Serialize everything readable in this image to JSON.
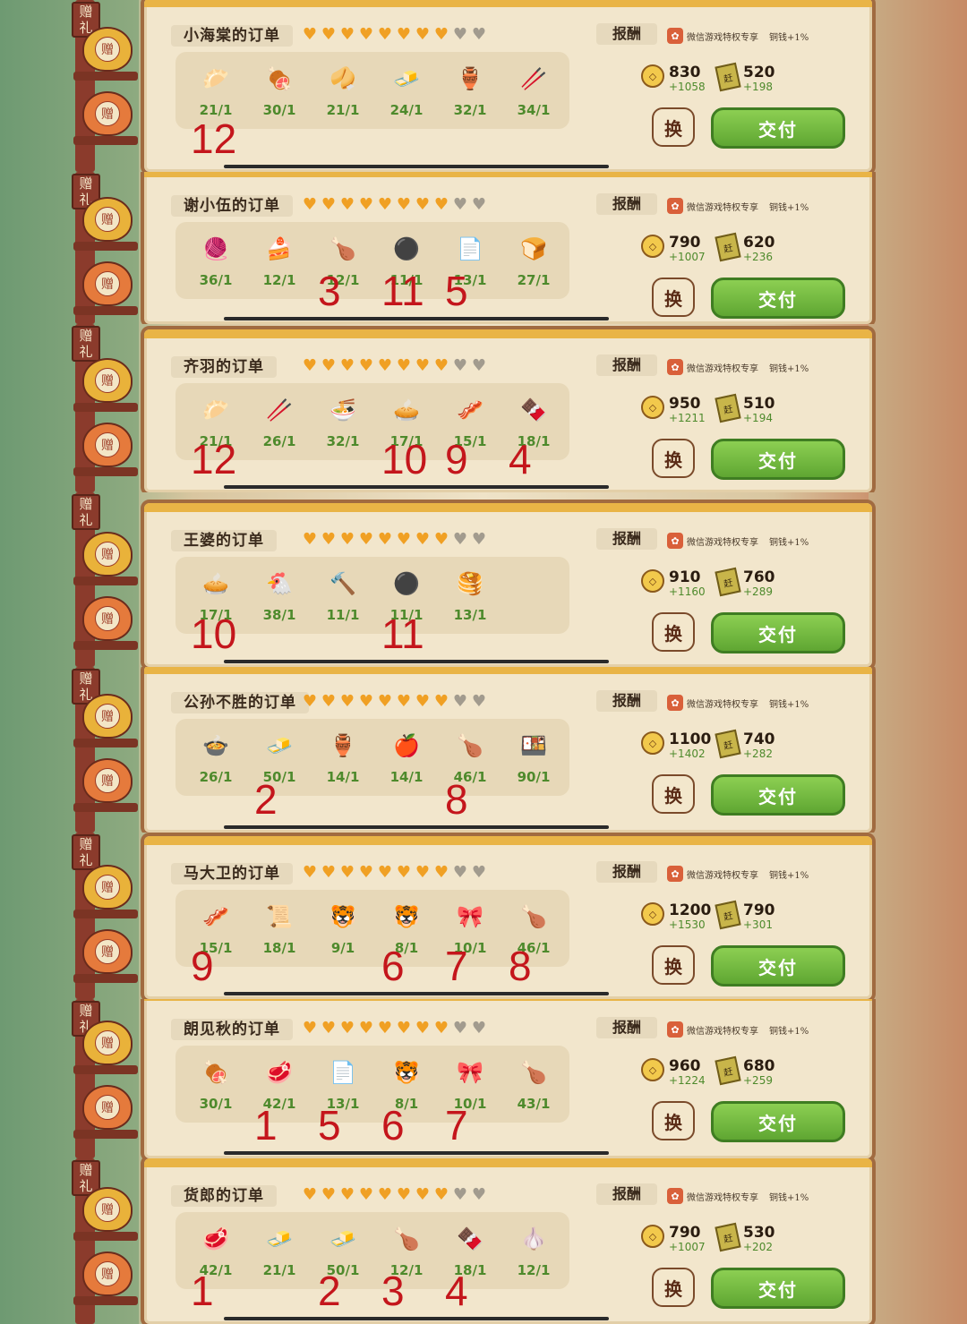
{
  "common": {
    "reward_label": "报酬",
    "vip_text": "微信游戏特权专享",
    "copper_bonus": "铜钱+1%",
    "swap_label": "换",
    "pay_label": "交付",
    "gift_bag_text": "赠",
    "gift_label": "赠礼",
    "coin_symbol": "◇",
    "ticket_symbol": "赶",
    "vip_symbol": "✿"
  },
  "orders": [
    {
      "title": "小海棠的订单",
      "hearts_full": 8,
      "hearts_total": 10,
      "items": [
        {
          "icon": "🥟",
          "count": "21/1"
        },
        {
          "icon": "🍖",
          "count": "30/1"
        },
        {
          "icon": "🥠",
          "count": "21/1"
        },
        {
          "icon": "🧈",
          "count": "24/1"
        },
        {
          "icon": "🏺",
          "count": "32/1"
        },
        {
          "icon": "🥢",
          "count": "34/1"
        }
      ],
      "coins": "830",
      "coins_bonus": "+1058",
      "tickets": "520",
      "tickets_bonus": "+198",
      "marks": [
        {
          "text": "12",
          "pos": 0
        }
      ]
    },
    {
      "title": "谢小伍的订单",
      "hearts_full": 8,
      "hearts_total": 10,
      "items": [
        {
          "icon": "🧶",
          "count": "36/1"
        },
        {
          "icon": "🍰",
          "count": "12/1"
        },
        {
          "icon": "🍗",
          "count": "12/1"
        },
        {
          "icon": "⚫",
          "count": "11/1"
        },
        {
          "icon": "📄",
          "count": "13/1"
        },
        {
          "icon": "🍞",
          "count": "27/1"
        }
      ],
      "coins": "790",
      "coins_bonus": "+1007",
      "tickets": "620",
      "tickets_bonus": "+236",
      "marks": [
        {
          "text": "3",
          "pos": 2
        },
        {
          "text": "11",
          "pos": 3
        },
        {
          "text": "5",
          "pos": 4
        }
      ]
    },
    {
      "title": "齐羽的订单",
      "hearts_full": 8,
      "hearts_total": 10,
      "items": [
        {
          "icon": "🥟",
          "count": "21/1"
        },
        {
          "icon": "🥢",
          "count": "26/1"
        },
        {
          "icon": "🍜",
          "count": "32/1"
        },
        {
          "icon": "🥧",
          "count": "17/1"
        },
        {
          "icon": "🥓",
          "count": "15/1"
        },
        {
          "icon": "🍫",
          "count": "18/1"
        }
      ],
      "coins": "950",
      "coins_bonus": "+1211",
      "tickets": "510",
      "tickets_bonus": "+194",
      "marks": [
        {
          "text": "12",
          "pos": 0
        },
        {
          "text": "10",
          "pos": 3
        },
        {
          "text": "9",
          "pos": 4
        },
        {
          "text": "4",
          "pos": 5
        }
      ]
    },
    {
      "title": "王婆的订单",
      "hearts_full": 8,
      "hearts_total": 10,
      "items": [
        {
          "icon": "🥧",
          "count": "17/1"
        },
        {
          "icon": "🐔",
          "count": "38/1"
        },
        {
          "icon": "🔨",
          "count": "11/1"
        },
        {
          "icon": "⚫",
          "count": "11/1"
        },
        {
          "icon": "🥞",
          "count": "13/1"
        }
      ],
      "coins": "910",
      "coins_bonus": "+1160",
      "tickets": "760",
      "tickets_bonus": "+289",
      "marks": [
        {
          "text": "10",
          "pos": 0
        },
        {
          "text": "11",
          "pos": 3
        }
      ]
    },
    {
      "title": "公孙不胜的订单",
      "hearts_full": 8,
      "hearts_total": 10,
      "items": [
        {
          "icon": "🍲",
          "count": "26/1"
        },
        {
          "icon": "🧈",
          "count": "50/1"
        },
        {
          "icon": "🏺",
          "count": "14/1"
        },
        {
          "icon": "🍎",
          "count": "14/1"
        },
        {
          "icon": "🍗",
          "count": "46/1"
        },
        {
          "icon": "🍱",
          "count": "90/1"
        }
      ],
      "coins": "1100",
      "coins_bonus": "+1402",
      "tickets": "740",
      "tickets_bonus": "+282",
      "marks": [
        {
          "text": "2",
          "pos": 1
        },
        {
          "text": "8",
          "pos": 4
        }
      ]
    },
    {
      "title": "马大卫的订单",
      "hearts_full": 8,
      "hearts_total": 10,
      "items": [
        {
          "icon": "🥓",
          "count": "15/1"
        },
        {
          "icon": "📜",
          "count": "18/1"
        },
        {
          "icon": "🐯",
          "count": "9/1"
        },
        {
          "icon": "🐯",
          "count": "8/1"
        },
        {
          "icon": "🎀",
          "count": "10/1"
        },
        {
          "icon": "🍗",
          "count": "46/1"
        }
      ],
      "coins": "1200",
      "coins_bonus": "+1530",
      "tickets": "790",
      "tickets_bonus": "+301",
      "marks": [
        {
          "text": "9",
          "pos": 0
        },
        {
          "text": "6",
          "pos": 3
        },
        {
          "text": "7",
          "pos": 4
        },
        {
          "text": "8",
          "pos": 5
        }
      ]
    },
    {
      "title": "朗见秋的订单",
      "hearts_full": 8,
      "hearts_total": 10,
      "items": [
        {
          "icon": "🍖",
          "count": "30/1"
        },
        {
          "icon": "🥩",
          "count": "42/1"
        },
        {
          "icon": "📄",
          "count": "13/1"
        },
        {
          "icon": "🐯",
          "count": "8/1"
        },
        {
          "icon": "🎀",
          "count": "10/1"
        },
        {
          "icon": "🍗",
          "count": "43/1"
        }
      ],
      "coins": "960",
      "coins_bonus": "+1224",
      "tickets": "680",
      "tickets_bonus": "+259",
      "marks": [
        {
          "text": "1",
          "pos": 1
        },
        {
          "text": "5",
          "pos": 2
        },
        {
          "text": "6",
          "pos": 3
        },
        {
          "text": "7",
          "pos": 4
        }
      ]
    },
    {
      "title": "货郎的订单",
      "hearts_full": 8,
      "hearts_total": 10,
      "items": [
        {
          "icon": "🥩",
          "count": "42/1"
        },
        {
          "icon": "🧈",
          "count": "21/1"
        },
        {
          "icon": "🧈",
          "count": "50/1"
        },
        {
          "icon": "🍗",
          "count": "12/1"
        },
        {
          "icon": "🍫",
          "count": "18/1"
        },
        {
          "icon": "🧄",
          "count": "12/1"
        }
      ],
      "coins": "790",
      "coins_bonus": "+1007",
      "tickets": "530",
      "tickets_bonus": "+202",
      "marks": [
        {
          "text": "1",
          "pos": 0
        },
        {
          "text": "2",
          "pos": 2
        },
        {
          "text": "3",
          "pos": 3
        },
        {
          "text": "4",
          "pos": 4
        }
      ]
    }
  ]
}
